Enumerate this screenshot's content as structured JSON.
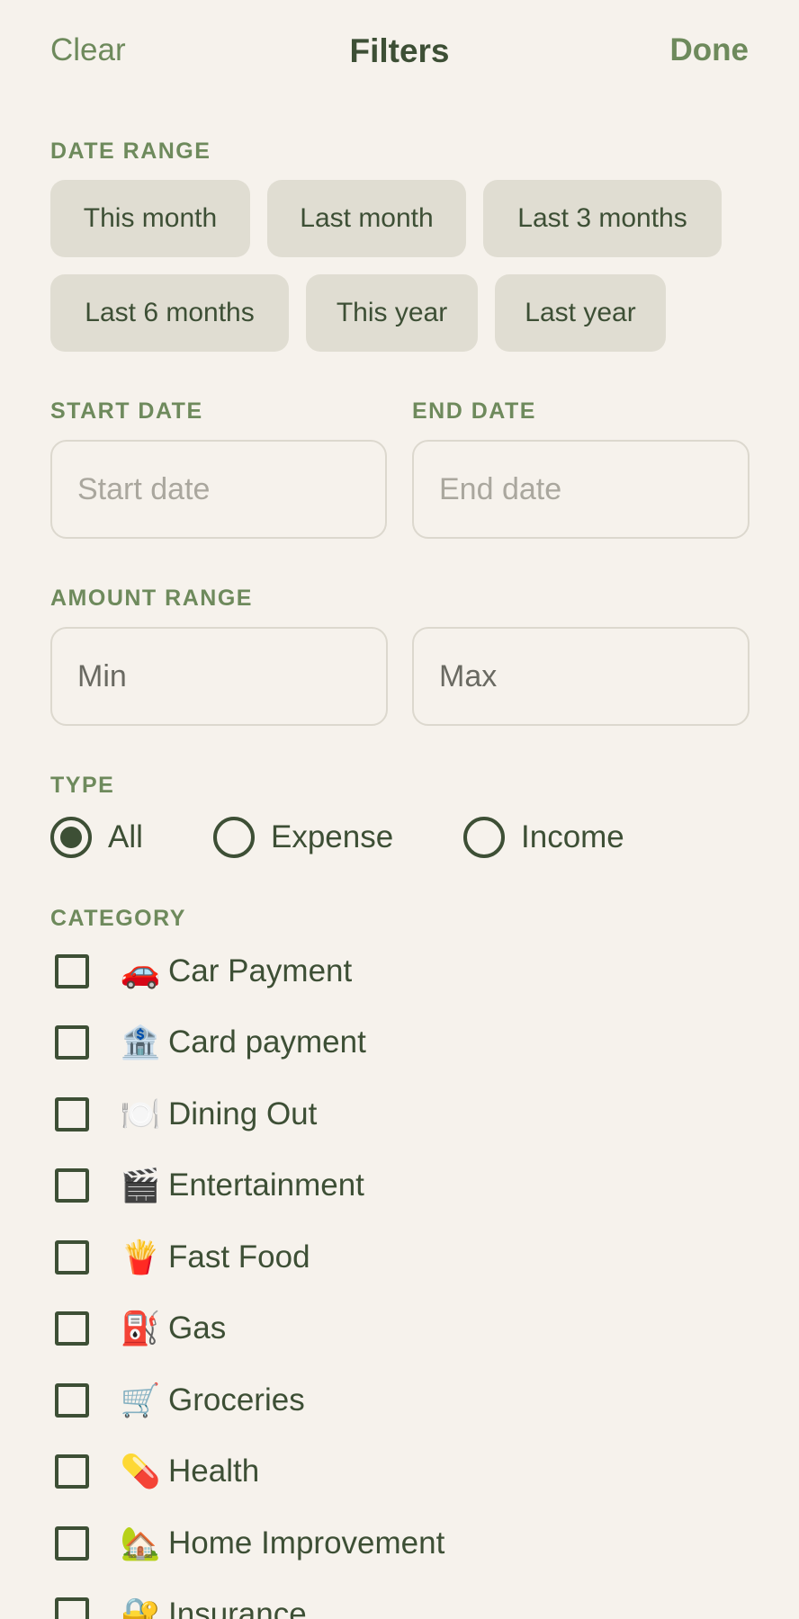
{
  "header": {
    "clear_label": "Clear",
    "title": "Filters",
    "done_label": "Done"
  },
  "date_range": {
    "label": "DATE RANGE",
    "chips": [
      "This month",
      "Last month",
      "Last 3 months",
      "Last 6 months",
      "This year",
      "Last year"
    ]
  },
  "start_date": {
    "label": "START DATE",
    "placeholder": "Start date"
  },
  "end_date": {
    "label": "END DATE",
    "placeholder": "End date"
  },
  "amount_range": {
    "label": "AMOUNT RANGE",
    "min_placeholder": "Min",
    "max_placeholder": "Max"
  },
  "type": {
    "label": "TYPE",
    "options": [
      "All",
      "Expense",
      "Income"
    ],
    "selected": "All"
  },
  "category": {
    "label": "CATEGORY",
    "items": [
      {
        "emoji": "🚗",
        "name": "Car Payment",
        "icon": "car-icon"
      },
      {
        "emoji": "🏦",
        "name": "Card payment",
        "icon": "bank-icon"
      },
      {
        "emoji": "🍽️",
        "name": "Dining Out",
        "icon": "plate-icon"
      },
      {
        "emoji": "🎬",
        "name": "Entertainment",
        "icon": "clapper-icon"
      },
      {
        "emoji": "🍟",
        "name": "Fast Food",
        "icon": "fries-icon"
      },
      {
        "emoji": "⛽",
        "name": "Gas",
        "icon": "fuel-pump-icon"
      },
      {
        "emoji": "🛒",
        "name": "Groceries",
        "icon": "cart-icon"
      },
      {
        "emoji": "💊",
        "name": "Health",
        "icon": "pill-icon"
      },
      {
        "emoji": "🏡",
        "name": "Home Improvement",
        "icon": "house-icon"
      },
      {
        "emoji": "🔐",
        "name": "Insurance",
        "icon": "lock-icon"
      }
    ]
  },
  "colors": {
    "background": "#f6f2ec",
    "accent": "#6e8a5c",
    "text": "#3d4f35",
    "chip": "#e0ddd2"
  }
}
